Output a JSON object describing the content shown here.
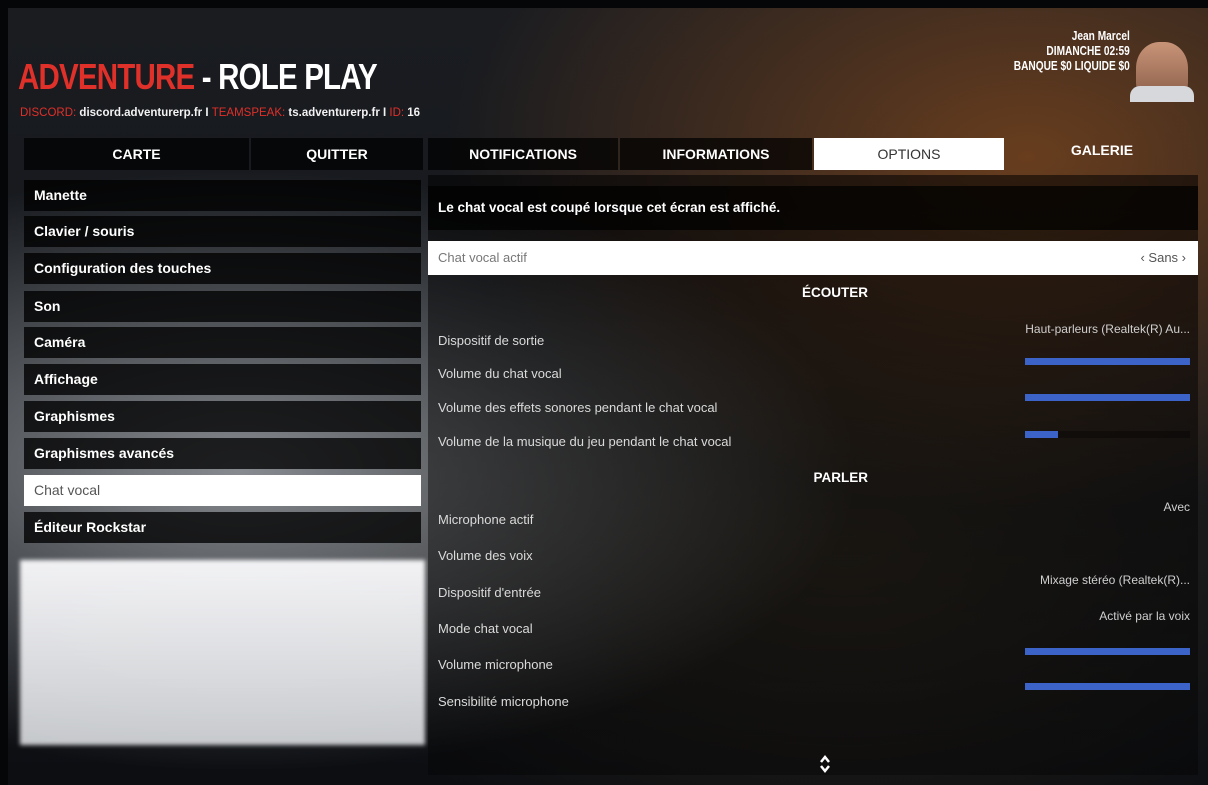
{
  "header": {
    "title_red": "ADVENTURE",
    "title_white": " - ROLE PLAY",
    "discord_label": "DISCORD:",
    "discord_value": " discord.adventurerp.fr I ",
    "teamspeak_label": "TEAMSPEAK:",
    "teamspeak_value": " ts.adventurerp.fr I ",
    "id_label": "ID",
    "id_sep": ": ",
    "id_value": "16"
  },
  "player": {
    "name": "Jean Marcel",
    "datetime": "DIMANCHE 02:59",
    "money": "BANQUE $0  LIQUIDE $0"
  },
  "tabs": [
    {
      "label": "CARTE"
    },
    {
      "label": "QUITTER"
    },
    {
      "label": "NOTIFICATIONS"
    },
    {
      "label": "INFORMATIONS"
    },
    {
      "label": "OPTIONS"
    },
    {
      "label": "GALERIE"
    }
  ],
  "menu": [
    {
      "label": "Manette"
    },
    {
      "label": "Clavier / souris"
    },
    {
      "label": "Configuration des touches"
    },
    {
      "label": "Son"
    },
    {
      "label": "Caméra"
    },
    {
      "label": "Affichage"
    },
    {
      "label": "Graphismes"
    },
    {
      "label": "Graphismes avancés"
    },
    {
      "label": "Chat vocal"
    },
    {
      "label": "Éditeur Rockstar"
    }
  ],
  "panel": {
    "notice": "Le chat vocal est coupé lorsque cet écran est affiché.",
    "active_row": {
      "label": "Chat vocal actif",
      "value": "‹ Sans ›"
    },
    "section_listen": "ÉCOUTER",
    "listen_rows": [
      {
        "label": "Dispositif de sortie",
        "value": "Haut-parleurs (Realtek(R) Au..."
      },
      {
        "label": "Volume du chat vocal",
        "level": 1.0
      },
      {
        "label": "Volume des effets sonores pendant le chat vocal",
        "level": 1.0
      },
      {
        "label": "Volume de la musique du jeu pendant le chat vocal",
        "level": 0.2
      }
    ],
    "section_speak": "PARLER",
    "speak_rows": [
      {
        "label": "Microphone actif",
        "value": "Avec"
      },
      {
        "label": "Volume des voix"
      },
      {
        "label": "Dispositif d'entrée",
        "value": "Mixage stéréo (Realtek(R)..."
      },
      {
        "label": "Mode chat vocal",
        "value": "Activé par la voix"
      },
      {
        "label": "Volume microphone",
        "level": 1.0
      },
      {
        "label": "Sensibilité microphone",
        "level": 1.0
      }
    ]
  },
  "colors": {
    "accent_red": "#e0302a",
    "bar_blue": "#3c63c8"
  },
  "icons": {
    "scroll": "up-down-arrows-icon"
  }
}
